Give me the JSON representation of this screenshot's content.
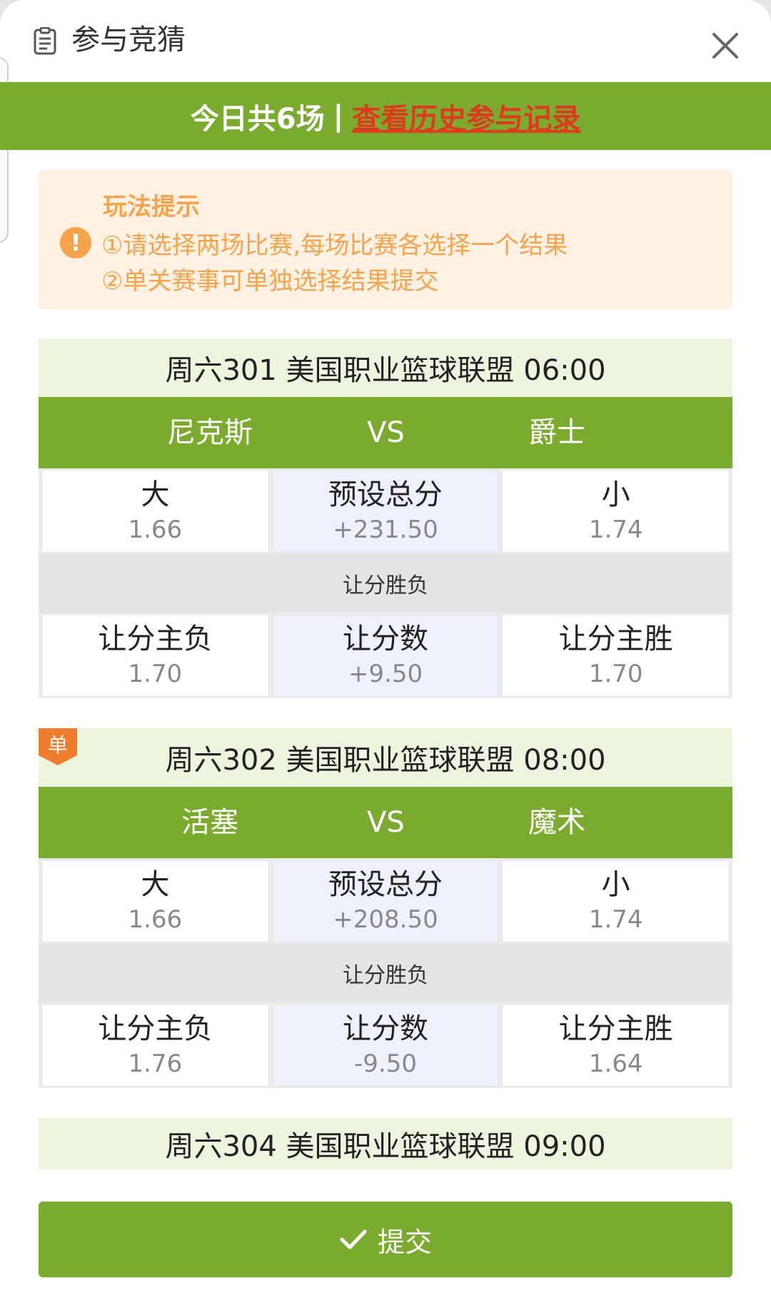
{
  "header": {
    "title": "参与竞猜",
    "icon": "clipboard-icon",
    "close_icon": "close-icon"
  },
  "banner": {
    "today_count": "今日共6场",
    "separator": "|",
    "history_link": "查看历史参与记录"
  },
  "tips": {
    "title": "玩法提示",
    "icon": "!",
    "lines": [
      "①请选择两场比赛,每场比赛各选择一个结果",
      "②单关赛事可单独选择结果提交"
    ]
  },
  "section_label": "让分胜负",
  "matches": [
    {
      "header": "周六301 美国职业篮球联盟 06:00",
      "home": "尼克斯",
      "vs": "VS",
      "away": "爵士",
      "total": {
        "over_label": "大",
        "over_odds": "1.66",
        "line_label": "预设总分",
        "line_value": "+231.50",
        "under_label": "小",
        "under_odds": "1.74"
      },
      "handicap": {
        "lose_label": "让分主负",
        "lose_odds": "1.70",
        "line_label": "让分数",
        "line_value": "+9.50",
        "win_label": "让分主胜",
        "win_odds": "1.70"
      }
    },
    {
      "header": "周六302 美国职业篮球联盟 08:00",
      "badge": "单",
      "home": "活塞",
      "vs": "VS",
      "away": "魔术",
      "total": {
        "over_label": "大",
        "over_odds": "1.66",
        "line_label": "预设总分",
        "line_value": "+208.50",
        "under_label": "小",
        "under_odds": "1.74"
      },
      "handicap": {
        "lose_label": "让分主负",
        "lose_odds": "1.76",
        "line_label": "让分数",
        "line_value": "-9.50",
        "win_label": "让分主胜",
        "win_odds": "1.64"
      }
    },
    {
      "header": "周六304 美国职业篮球联盟 09:00"
    }
  ],
  "submit": {
    "label": "提交",
    "icon": "check-icon"
  },
  "colors": {
    "green": "#7aab2f",
    "orange": "#f5a44b",
    "link_red": "#e0391e"
  }
}
